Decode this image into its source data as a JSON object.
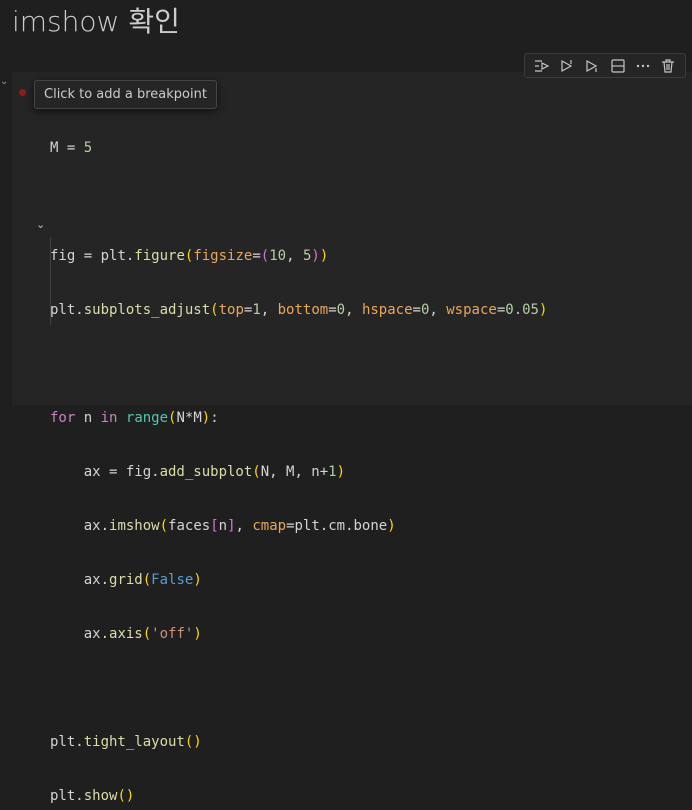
{
  "heading": "imshow 확인",
  "tooltip": "Click to add a breakpoint",
  "toolbar": {
    "icons": [
      "run-by-line-icon",
      "execute-above-icon",
      "execute-below-icon",
      "split-cell-icon",
      "more-actions-icon",
      "delete-cell-icon"
    ]
  },
  "code": {
    "l1": {
      "a": "M",
      "b": " = ",
      "c": "5"
    },
    "l3": {
      "a": "fig",
      "b": " = plt.",
      "c": "figure",
      "d": "(",
      "e": "figsize",
      "f": "=",
      "g": "(",
      "h": "10",
      ",": ", ",
      "i": "5",
      "j": ")",
      "k": ")"
    },
    "l4": {
      "a": "plt.",
      "b": "subplots_adjust",
      "c": "(",
      "d": "top",
      "e": "=",
      "f": "1",
      ",1": ", ",
      "g": "bottom",
      "h": "=",
      "i": "0",
      ",2": ", ",
      "j": "hspace",
      "k": "=",
      "l": "0",
      ",3": ", ",
      "m": "wspace",
      "n": "=",
      "o": "0.05",
      "p": ")"
    },
    "l6": {
      "a": "for",
      "b": " n ",
      "c": "in",
      "d": " ",
      "e": "range",
      "f": "(",
      "g": "N*M",
      "h": ")",
      "i": ":"
    },
    "l7": {
      "a": "    ax = fig.",
      "b": "add_subplot",
      "c": "(",
      "d": "N, M, n+",
      "e": "1",
      "f": ")"
    },
    "l8": {
      "a": "    ax.",
      "b": "imshow",
      "c": "(",
      "d": "faces",
      "e": "[",
      "f": "n",
      "g": "]",
      ",": ", ",
      "h": "cmap",
      "i": "=plt.cm.bone",
      "j": ")"
    },
    "l9": {
      "a": "    ax.",
      "b": "grid",
      "c": "(",
      "d": "False",
      "e": ")"
    },
    "l10": {
      "a": "    ax.",
      "b": "axis",
      "c": "(",
      "d": "'off'",
      "e": ")"
    },
    "l12": {
      "a": "plt.",
      "b": "tight_layout",
      "c": "()"
    },
    "l13": {
      "a": "plt.",
      "b": "show",
      "c": "()"
    }
  }
}
